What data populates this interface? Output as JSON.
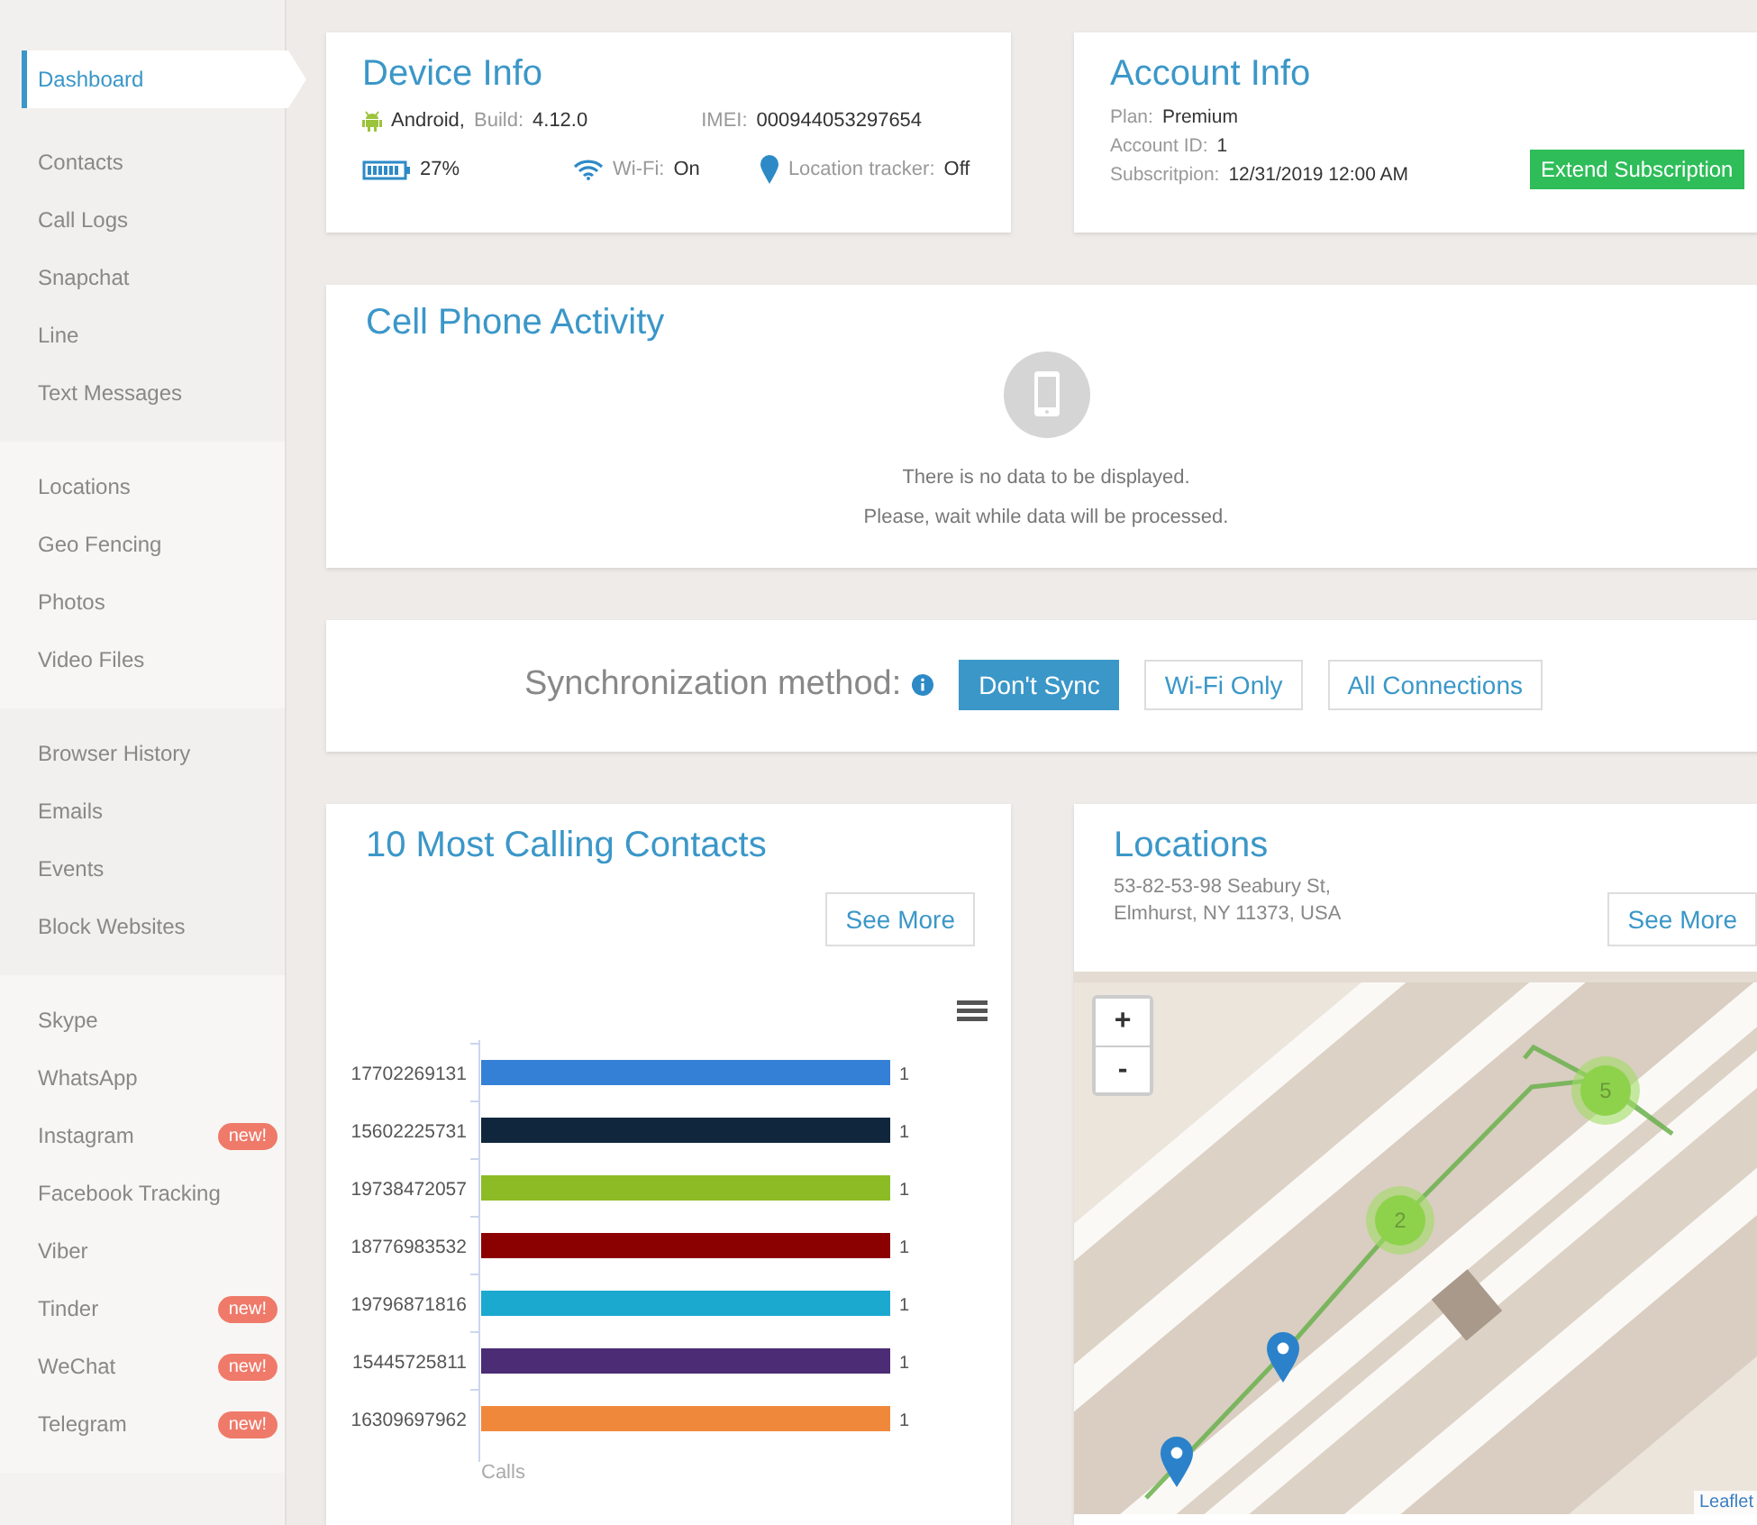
{
  "sidebar": {
    "groups": [
      {
        "items": [
          {
            "label": "Dashboard",
            "selected": true
          },
          {
            "label": "Contacts",
            "selected": false
          },
          {
            "label": "Call Logs",
            "selected": false
          },
          {
            "label": "Snapchat",
            "selected": false
          },
          {
            "label": "Line",
            "selected": false
          },
          {
            "label": "Text Messages",
            "selected": false
          }
        ]
      },
      {
        "items": [
          {
            "label": "Locations",
            "selected": false
          },
          {
            "label": "Geo Fencing",
            "selected": false
          },
          {
            "label": "Photos",
            "selected": false
          },
          {
            "label": "Video Files",
            "selected": false
          }
        ]
      },
      {
        "items": [
          {
            "label": "Browser History",
            "selected": false
          },
          {
            "label": "Emails",
            "selected": false
          },
          {
            "label": "Events",
            "selected": false
          },
          {
            "label": "Block Websites",
            "selected": false
          }
        ]
      },
      {
        "items": [
          {
            "label": "Skype",
            "selected": false
          },
          {
            "label": "WhatsApp",
            "selected": false
          },
          {
            "label": "Instagram",
            "selected": false,
            "badge": "new!"
          },
          {
            "label": "Facebook Tracking",
            "selected": false
          },
          {
            "label": "Viber",
            "selected": false
          },
          {
            "label": "Tinder",
            "selected": false,
            "badge": "new!"
          },
          {
            "label": "WeChat",
            "selected": false,
            "badge": "new!"
          },
          {
            "label": "Telegram",
            "selected": false,
            "badge": "new!"
          }
        ]
      }
    ]
  },
  "device_info": {
    "title": "Device Info",
    "os": "Android,",
    "build_label": "Build:",
    "build": "4.12.0",
    "imei_label": "IMEI:",
    "imei": "000944053297654",
    "battery": "27%",
    "wifi_label": "Wi-Fi:",
    "wifi": "On",
    "location_label": "Location tracker:",
    "location": "Off"
  },
  "account_info": {
    "title": "Account Info",
    "fields": [
      {
        "label": "Plan:",
        "value": "Premium"
      },
      {
        "label": "Account ID:",
        "value": "1"
      },
      {
        "label": "Subscritpion:",
        "value": "12/31/2019 12:00 AM"
      }
    ],
    "button": "Extend Subscription"
  },
  "cell_phone_activity": {
    "title": "Cell Phone Activity",
    "messages": [
      "There is no data to be displayed.",
      "Please, wait while data will be processed."
    ]
  },
  "synchronization": {
    "label": "Synchronization method:",
    "options": [
      {
        "label": "Don't Sync",
        "selected": true
      },
      {
        "label": "Wi-Fi Only",
        "selected": false
      },
      {
        "label": "All Connections",
        "selected": false
      }
    ]
  },
  "calling_contacts": {
    "title": "10 Most Calling Contacts",
    "button": "See More",
    "chart_data": {
      "type": "bar",
      "orientation": "horizontal",
      "xlabel": "Calls",
      "data_labels": true,
      "categories": [
        "17702269131",
        "15602225731",
        "19738472057",
        "18776983532",
        "19796871816",
        "15445725811",
        "16309697962"
      ],
      "colors": [
        "#3480d6",
        "#10263d",
        "#8dbb25",
        "#8b0000",
        "#1ba9d0",
        "#4b2c75",
        "#f0883c"
      ],
      "series": [
        {
          "values": [
            1,
            1,
            1,
            1,
            1,
            1,
            1
          ]
        }
      ]
    }
  },
  "locations": {
    "title": "Locations",
    "address": [
      "53-82-53-98 Seabury St,",
      "Elmhurst, NY 11373, USA"
    ],
    "button": "See More",
    "map": {
      "kind": "picture",
      "zoom_in": "+",
      "zoom_out": "-",
      "clusters": [
        "2",
        "5"
      ],
      "attribution": "Leaflet"
    }
  }
}
